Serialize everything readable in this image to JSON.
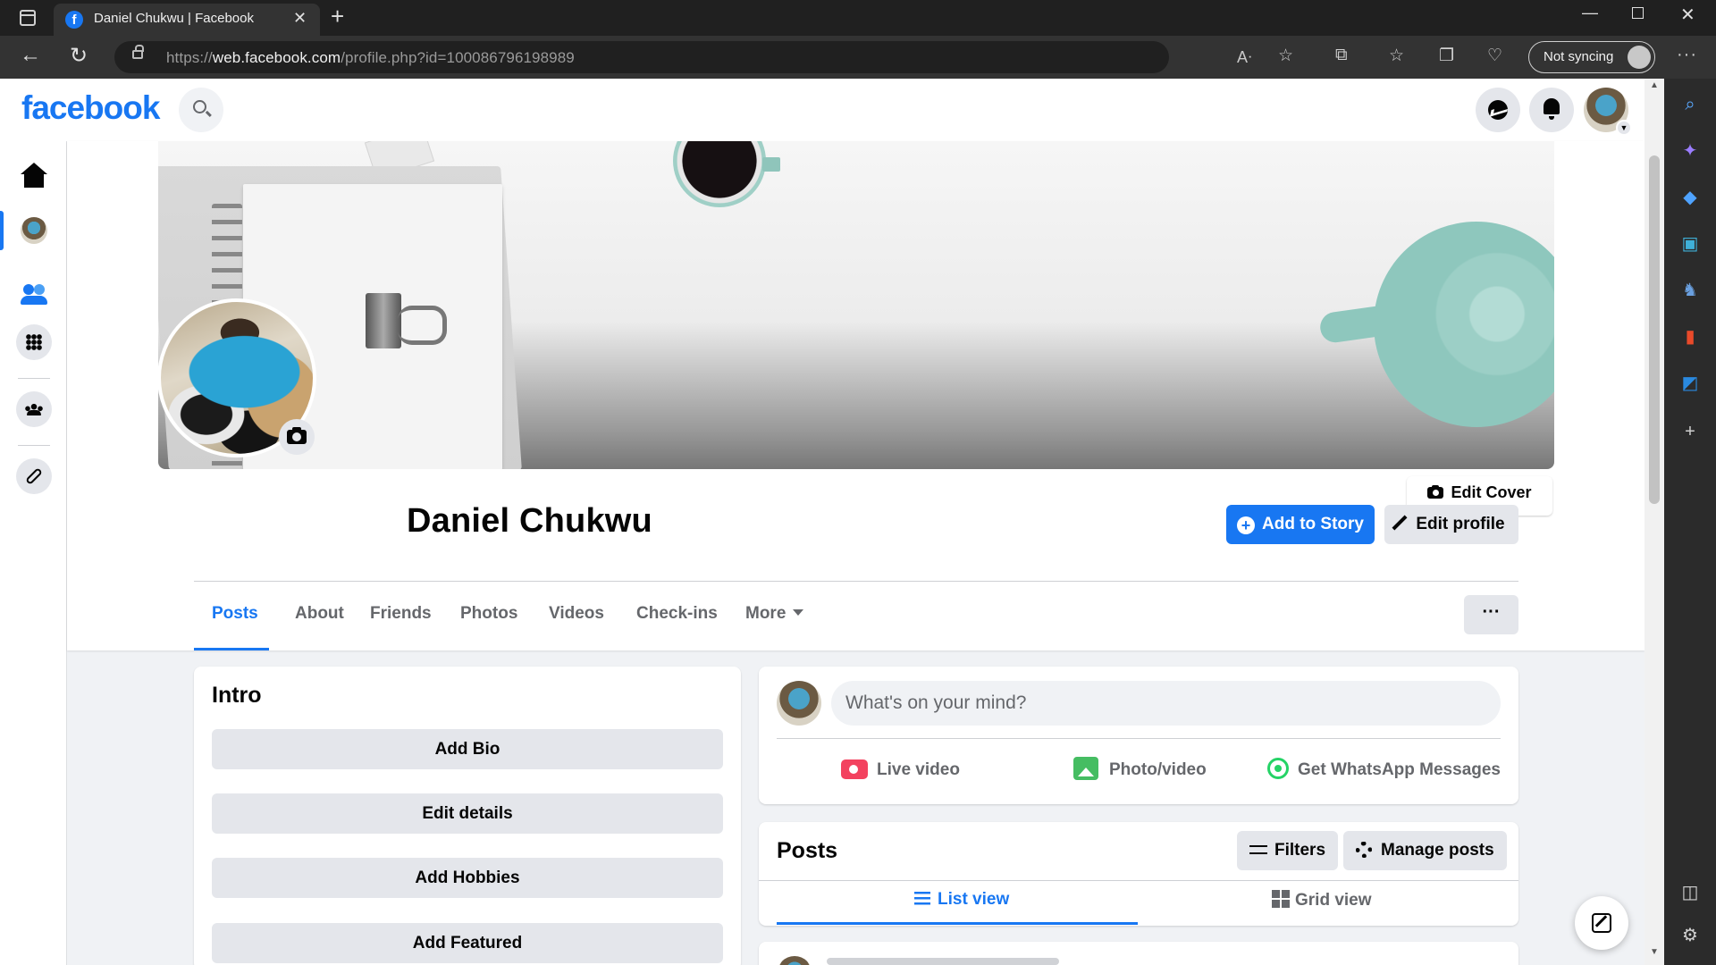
{
  "browser": {
    "tab_title": "Daniel Chukwu | Facebook",
    "url_prefix": "https://",
    "url_host": "web.facebook.com",
    "url_path": "/profile.php?id=100086796198989",
    "sync_label": "Not syncing"
  },
  "facebook": {
    "logo": "facebook",
    "brand_color": "#1877f2"
  },
  "profile": {
    "name": "Daniel Chukwu",
    "edit_cover_label": "Edit Cover Photo",
    "add_story_label": "Add to Story",
    "edit_profile_label": "Edit profile"
  },
  "profile_tabs": [
    {
      "label": "Posts",
      "active": true
    },
    {
      "label": "About"
    },
    {
      "label": "Friends"
    },
    {
      "label": "Photos"
    },
    {
      "label": "Videos"
    },
    {
      "label": "Check-ins"
    },
    {
      "label": "More"
    }
  ],
  "more_menu_label": "···",
  "intro": {
    "title": "Intro",
    "buttons": [
      "Add Bio",
      "Edit details",
      "Add Hobbies",
      "Add Featured"
    ]
  },
  "composer": {
    "placeholder": "What's on your mind?",
    "actions": [
      "Live video",
      "Photo/video",
      "Get WhatsApp Messages"
    ]
  },
  "posts": {
    "title": "Posts",
    "filters_label": "Filters",
    "manage_label": "Manage posts",
    "views": [
      "List view",
      "Grid view"
    ]
  },
  "icons": {
    "edge_sidebar": [
      "search-icon",
      "copilot-icon",
      "shopping-icon",
      "tools-icon",
      "games-icon",
      "office-icon",
      "outlook-icon",
      "add-icon",
      "split-screen-icon",
      "settings-icon"
    ]
  }
}
